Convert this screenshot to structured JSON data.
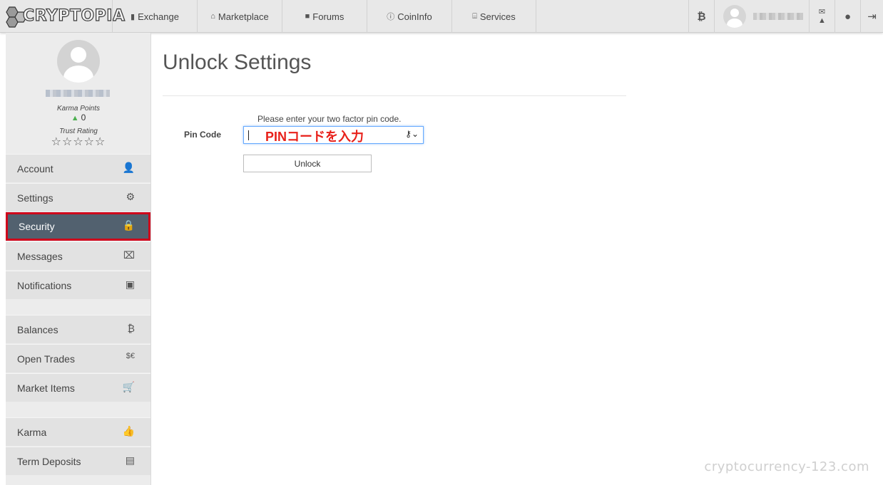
{
  "brand": {
    "logo_text": "CRYPTOPIA"
  },
  "nav": {
    "items": [
      {
        "icon": "chart-icon",
        "glyph": "▮",
        "label": "Exchange"
      },
      {
        "icon": "cart-icon",
        "glyph": "⌂",
        "label": "Marketplace"
      },
      {
        "icon": "comments-icon",
        "glyph": "■",
        "label": "Forums"
      },
      {
        "icon": "info-icon",
        "glyph": "ⓘ",
        "label": "CoinInfo"
      },
      {
        "icon": "bank-icon",
        "glyph": "⌸",
        "label": "Services"
      }
    ],
    "right": {
      "btc_glyph": "₿",
      "mail_glyph": "✉",
      "warn_glyph": "▲",
      "bulb_glyph": "●",
      "logout_glyph": "⇥"
    }
  },
  "profile": {
    "karma_label": "Karma Points",
    "karma_value": "0",
    "trust_label": "Trust Rating",
    "stars": "☆☆☆☆☆"
  },
  "sidebar": {
    "group1": [
      {
        "label": "Account",
        "glyph": "👤"
      },
      {
        "label": "Settings",
        "glyph": "⚙"
      },
      {
        "label": "Security",
        "glyph": "🔒",
        "active": true
      },
      {
        "label": "Messages",
        "glyph": "⌧"
      },
      {
        "label": "Notifications",
        "glyph": "▣"
      }
    ],
    "group2": [
      {
        "label": "Balances",
        "glyph": "₿"
      },
      {
        "label": "Open Trades",
        "glyph": "$€"
      },
      {
        "label": "Market Items",
        "glyph": "🛒"
      }
    ],
    "group3": [
      {
        "label": "Karma",
        "glyph": "👍"
      },
      {
        "label": "Term Deposits",
        "glyph": "▤"
      }
    ]
  },
  "main": {
    "title": "Unlock Settings",
    "hint": "Please enter your two factor pin code.",
    "pin_label": "Pin Code",
    "pin_overlay": "PINコードを入力",
    "pin_value": "",
    "unlock_label": "Unlock"
  },
  "watermark": "cryptocurrency-123.com",
  "colors": {
    "active_bg": "#52616f",
    "highlight_border": "#d0021b",
    "annotation": "#e8201a",
    "input_focus": "#66aaff"
  }
}
